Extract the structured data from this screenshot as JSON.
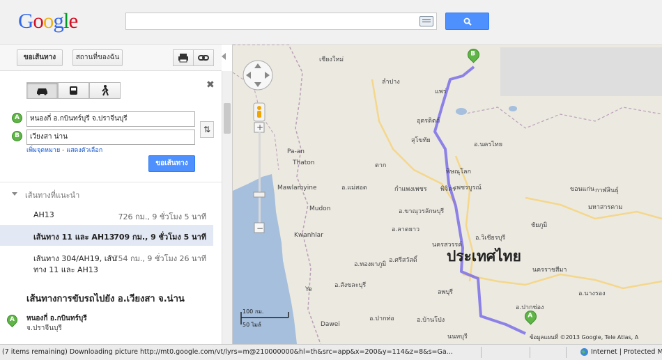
{
  "header": {
    "logo_text": "Google",
    "search_value": ""
  },
  "toolbar": {
    "directions_label": "ขอเส้นทาง",
    "my_places_label": "สถานที่ของฉัน"
  },
  "form": {
    "origin_marker": "A",
    "origin_value": "หนองกี่ อ.กบินทร์บุรี จ.ปราจีนบุรี",
    "destination_marker": "B",
    "destination_value": "เวียงสา น่าน",
    "add_destination_link": "เพิ่มจุดหมาย",
    "link_separator": "-",
    "show_options_link": "แสดงตัวเลือก",
    "get_directions_label": "ขอเส้นทาง"
  },
  "routes": {
    "heading": "เส้นทางที่แนะนำ",
    "items": [
      {
        "name": "AH13",
        "name2": "",
        "detail": "726 กม., 9 ชั่วโมง 5 นาที",
        "selected": false
      },
      {
        "name": "เส้นทาง 11 และ AH13",
        "name2": "",
        "detail": "709 กม., 9 ชั่วโมง 5 นาที",
        "selected": true
      },
      {
        "name": "เส้นทาง 304/AH19, เส้น",
        "name2": "ทาง 11 และ AH13",
        "detail": "754 กม., 9 ชั่วโมง 26 นาที",
        "selected": false
      }
    ]
  },
  "driving": {
    "title": "เส้นทางการขับรถไปยัง อ.เวียงสา จ.น่าน",
    "start_marker": "A",
    "start_name": "หนองกี่ อ.กบินทร์บุรี",
    "start_province": "จ.ปราจีนบุรี"
  },
  "map": {
    "country_label": "ประเทศไทย",
    "marker_a": "A",
    "marker_b": "B",
    "scale_km": "100 กม.",
    "scale_mi": "50 ไมล์",
    "copyright": "ข้อมูลแผนที่ ©2013 Google, Tele Atlas, A",
    "places": [
      "เชียงใหม่",
      "ลำปาง",
      "แพร่",
      "อุตรดิตถ์",
      "สุโขทัย",
      "ตาก",
      "พิษณุโลก",
      "พิจิตร",
      "เพชรบูรณ์",
      "กำแพงเพชร",
      "อ.นครไทย",
      "อ.แม่สอด",
      "อ.ขาณุวรลักษบุรี",
      "อ.ลาดยาว",
      "นครสวรรค์",
      "อ.วิเชียรบุรี",
      "ชัยภูมิ",
      "ขอนแก่น",
      "กาฬสินธุ์",
      "มหาสารคาม",
      "ลพบุรี",
      "นครราชสีมา",
      "อ.นางรอง",
      "อ.บ้านโป่ง",
      "อ.ทองผาภูมิ",
      "อ.ศรีสวัสดิ์",
      "อ.สังขละบุรี",
      "อ.ปากท่อ",
      "อ.ปากช่อง",
      "นนทบุรี",
      "Thaton",
      "Mawlamyine",
      "Mudon",
      "Kwanhlar",
      "Dawei",
      "Ye",
      "Pa-an"
    ],
    "route_color": "#7b6ee6",
    "water_color": "#a5bfdd"
  },
  "statusbar": {
    "text": "(7 items remaining) Downloading picture http://mt0.google.com/vt/lyrs=m@210000000&hl=th&src=app&x=200&y=114&z=8&s=Ga...",
    "zone": "Internet | Protected M"
  }
}
